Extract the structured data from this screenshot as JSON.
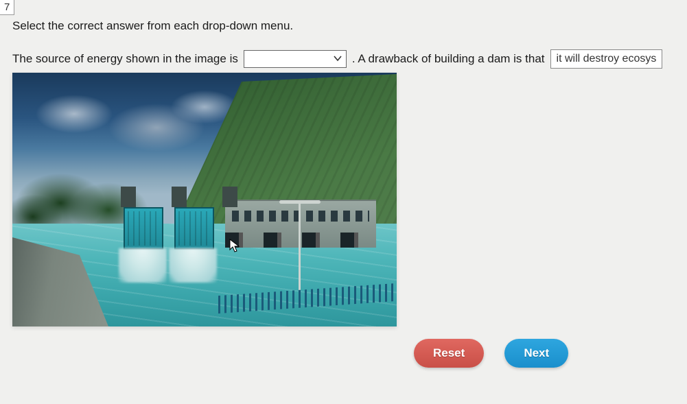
{
  "question_number": "7",
  "instruction": "Select the correct answer from each drop-down menu.",
  "sentence": {
    "part1": "The source of energy shown in the image is",
    "dropdown1_selected": "",
    "part2": ". A drawback of building a dam is that",
    "dropdown2_selected": "it will destroy ecosys"
  },
  "image_alt": "hydroelectric dam with spillways releasing water, mountains and reservoir",
  "buttons": {
    "reset": "Reset",
    "next": "Next"
  }
}
